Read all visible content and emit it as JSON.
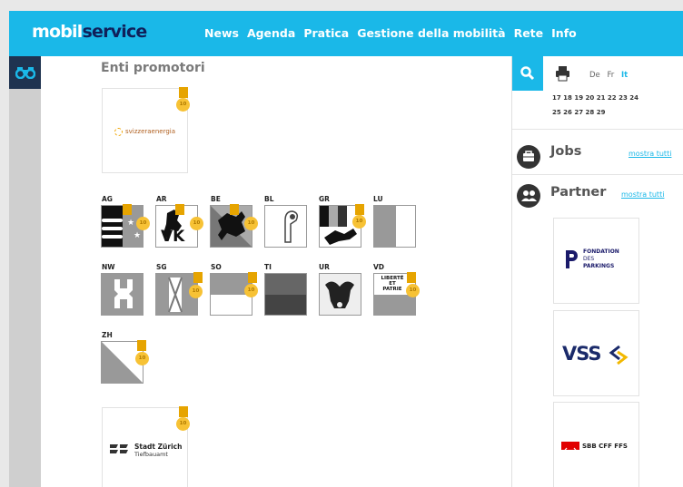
{
  "header": {
    "logo_part1": "mobil",
    "logo_part2": "service",
    "nav": [
      "News",
      "Agenda",
      "Pratica",
      "Gestione della mobilità",
      "Rete",
      "Info"
    ]
  },
  "main": {
    "title": "Enti promotori",
    "medal_text": "10",
    "swiss_energy_text": "svizzeraenergia",
    "cantons": [
      {
        "code": "AG"
      },
      {
        "code": "AR"
      },
      {
        "code": "BE"
      },
      {
        "code": "BL"
      },
      {
        "code": "GR"
      },
      {
        "code": "LU"
      },
      {
        "code": "NW"
      },
      {
        "code": "SG"
      },
      {
        "code": "SO"
      },
      {
        "code": "TI"
      },
      {
        "code": "UR"
      },
      {
        "code": "VD"
      },
      {
        "code": "ZH"
      }
    ],
    "vk_text": "VK",
    "vd_text1": "LIBERTÉ",
    "vd_text2": "ET",
    "vd_text3": "PATRIE",
    "stadt_title": "Stadt Zürich",
    "stadt_sub": "Tiefbauamt"
  },
  "sidebar": {
    "langs": [
      "De",
      "Fr",
      "It"
    ],
    "active_lang": "It",
    "calendar_row1": "17  18  19  20  21  22  23  24",
    "calendar_row2": "25  26  27  28  29",
    "jobs_title": "Jobs",
    "jobs_link": "mostra tutti",
    "partner_title": "Partner",
    "partner_link": "mostra tutti",
    "fdp_line1": "FONDATION",
    "fdp_line2": "DES",
    "fdp_line3": "PARKINGS",
    "vss_text": "VSS",
    "sbb_text": "SBB CFF FFS"
  },
  "icons": {
    "search": "search-icon",
    "binoculars": "binoculars-icon",
    "print": "print-icon",
    "briefcase": "briefcase-icon",
    "people": "people-icon"
  },
  "colors": {
    "accent": "#1ab8e8",
    "dark": "#1f3350",
    "medal": "#f7c235",
    "stripe": "#e6a400"
  }
}
